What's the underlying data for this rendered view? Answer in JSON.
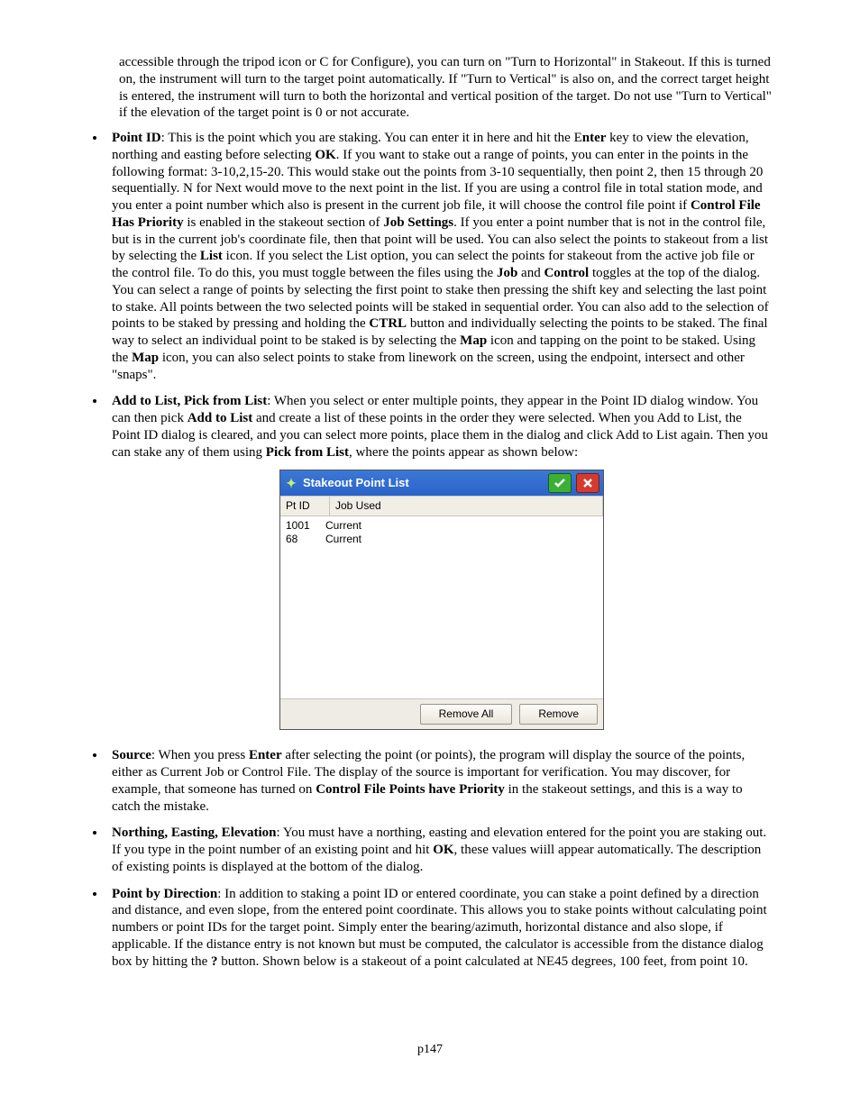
{
  "intro": "accessible through the tripod icon or C for Configure), you can turn on \"Turn to Horizontal\" in Stakeout.  If this is turned on, the instrument will turn to the target point automatically.  If \"Turn to Vertical\" is also on, and the correct target height is entered, the instrument will turn to both the horizontal and vertical position of the target.  Do not use \"Turn to Vertical\" if the elevation of the target point is 0 or not accurate.",
  "li_pointid": {
    "label": "Point ID",
    "seg1": ": This is the point which you are staking. You can enter it in here and hit the E",
    "b_enter": "nter",
    "seg2": " key to view the elevation, northing and easting before selecting ",
    "b_ok": "OK",
    "seg3": ".  If you want to stake out a range of points, you can enter in the points in the following format: 3-10,2,15-20.  This would stake out the points from 3-10 sequentially, then point 2, then 15 through 20 sequentially. N for Next would move to the next point in the list.  If you are using a control file in total station mode, and you enter a point number which also is present in the current job file, it will choose the control file point if ",
    "b_cfhp": "Control File Has Priority",
    "seg4": " is enabled in the stakeout section of ",
    "b_js": "Job Settings",
    "seg5": ". If you enter a point number that is not in the control file, but is in the current job's coordinate file, then that point will be used. You can also select the points to stakeout from a list by selecting the ",
    "b_list": "List",
    "seg6": " icon.  If you select the List option, you can select the points for stakeout from the active job file or the control file.  To do this,  you must toggle between the files using the ",
    "b_job": "Job",
    "seg7": " and ",
    "b_control": "Control",
    "seg8": " toggles at the top of the dialog.  You can select a range of points by selecting the first point to stake then pressing the shift key and selecting the last point to stake.  All points between the two selected points will be staked in sequential order.  You can also add to the selection of points to be staked by pressing and holding the ",
    "b_ctrl": "CTRL",
    "seg9": " button and individually selecting the points to be staked.  The final way to select an individual point to be staked is by selecting the ",
    "b_map1": "Map",
    "seg10": " icon and tapping on the point to be staked.  Using the ",
    "b_map2": "Map",
    "seg11": " icon, you can also select points to stake from linework on the screen, using the endpoint, intersect and other \"snaps\"."
  },
  "li_addlist": {
    "label": "Add to List, Pick from List",
    "seg1": ": When you select or enter multiple points, they appear in the Point ID dialog window.  You can then pick ",
    "b_add": "Add to List",
    "seg2": " and create a list of these points in the order they were selected.  When you Add to List, the Point ID dialog is cleared, and you can select more points, place them in the dialog and click Add to List again.  Then you can stake any of them using ",
    "b_pick": "Pick from List",
    "seg3": ", where the points appear as shown below:"
  },
  "dialog": {
    "title": "Stakeout Point List",
    "col1": "Pt ID",
    "col2": "Job Used",
    "rows": [
      {
        "id": "1001",
        "job": "Current"
      },
      {
        "id": "68",
        "job": "Current"
      }
    ],
    "btn_remove_all": "Remove All",
    "btn_remove": "Remove"
  },
  "li_source": {
    "label": "Source",
    "seg1": ": When you press ",
    "b_enter": "Enter",
    "seg2": " after selecting the point (or points), the program will display the source of the points, either as Current Job or Control File. The display of the source is important for verification. You may discover, for example, that someone has turned on ",
    "b_cfphp": "Control File Points have Priority",
    "seg3": " in the stakeout settings, and this is a way to catch the mistake."
  },
  "li_nee": {
    "label": "Northing, Easting, Elevation",
    "seg1": ": You must have a northing, easting and elevation entered for the point you are staking out. If you type in the point number of an existing point and hit ",
    "b_ok": "OK",
    "seg2": ", these values wiill appear automatically. The description of existing points is displayed at the bottom of the dialog."
  },
  "li_pbd": {
    "label": "Point by Direction",
    "seg1": ":  In addition to staking a point ID or entered coordinate, you can stake a point defined by a direction and distance, and even slope, from the entered point coordinate.  This allows you to stake points without calculating point numbers or point IDs for the target point.  Simply enter the bearing/azimuth, horizontal distance and also slope, if applicable.  If the distance entry is not known but must be computed, the calculator is accessible from the distance dialog box by hitting the ",
    "b_q": "?",
    "seg2": " button.   Shown below is a stakeout of a point calculated at NE45 degrees, 100 feet, from point 10."
  },
  "footer": "p147"
}
